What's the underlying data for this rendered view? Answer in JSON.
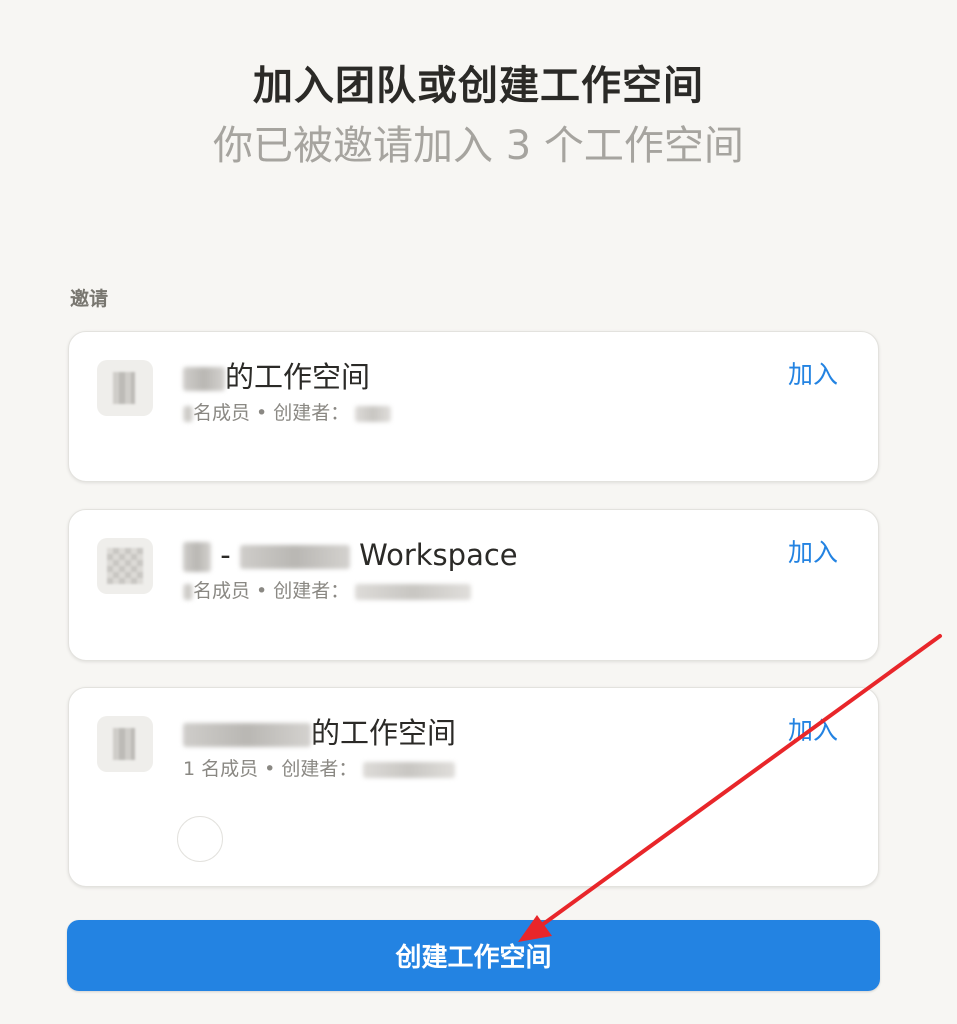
{
  "header": {
    "title": "加入团队或创建工作空间",
    "subtitle": "你已被邀请加入 3 个工作空间"
  },
  "invites": {
    "label": "邀请",
    "items": [
      {
        "name_suffix": "的工作空间",
        "meta_text": "名成员 • 创建者：",
        "join_label": "加入"
      },
      {
        "name_prefix": "-",
        "name_suffix": "Workspace",
        "meta_text": "名成员 • 创建者：",
        "join_label": "加入"
      },
      {
        "name_suffix": "的工作空间",
        "meta_text": "1 名成员 • 创建者：",
        "join_label": "加入"
      }
    ]
  },
  "footer": {
    "create_label": "创建工作空间"
  },
  "colors": {
    "accent": "#2383e2",
    "annotation": "#e8262a",
    "background": "#f7f6f3"
  },
  "icons": {
    "workspace_avatar": "workspace-avatar-icon",
    "annotation": "red-arrow"
  }
}
